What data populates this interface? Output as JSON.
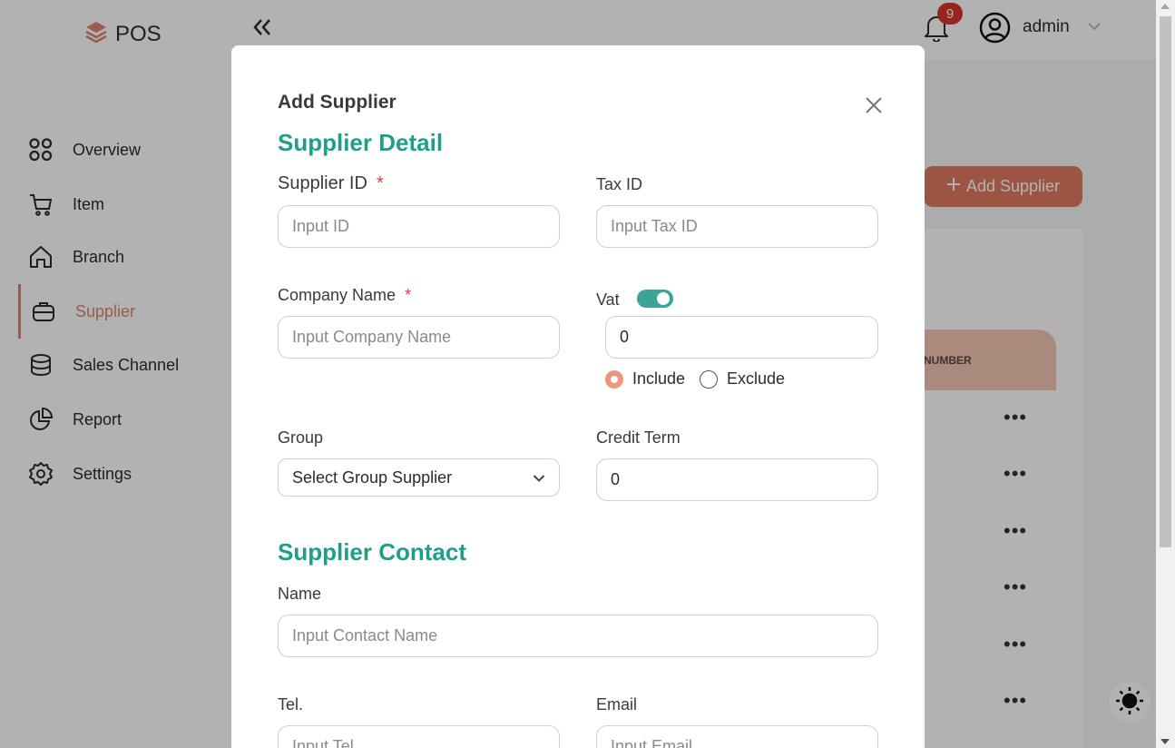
{
  "app": {
    "logo_text": "POS"
  },
  "sidebar": {
    "items": [
      {
        "label": "Overview",
        "icon": "grid-icon"
      },
      {
        "label": "Item",
        "icon": "cart-icon"
      },
      {
        "label": "Branch",
        "icon": "home-icon"
      },
      {
        "label": "Supplier",
        "icon": "briefcase-icon",
        "active": true
      },
      {
        "label": "Sales Channel",
        "icon": "database-icon"
      },
      {
        "label": "Report",
        "icon": "pie-chart-icon"
      },
      {
        "label": "Settings",
        "icon": "gear-icon"
      }
    ]
  },
  "header": {
    "notification_count": "9",
    "user_name": "admin"
  },
  "page": {
    "add_button_label": "Add Supplier",
    "table_header_partial": "NUMBER"
  },
  "modal": {
    "title": "Add Supplier",
    "detail_section": "Supplier Detail",
    "supplier_id": {
      "label": "Supplier ID",
      "required": "*",
      "placeholder": "Input ID"
    },
    "tax_id": {
      "label": "Tax ID",
      "placeholder": "Input Tax ID"
    },
    "company_name": {
      "label": "Company Name",
      "required": "*",
      "placeholder": "Input Company Name"
    },
    "vat": {
      "label": "Vat",
      "value": "0",
      "enabled": true,
      "include_label": "Include",
      "exclude_label": "Exclude",
      "selected": "Include"
    },
    "group": {
      "label": "Group",
      "selected": "Select Group Supplier"
    },
    "credit_term": {
      "label": "Credit Term",
      "value": "0"
    },
    "contact_section": "Supplier Contact",
    "contact_name": {
      "label": "Name",
      "placeholder": "Input Contact Name"
    },
    "tel": {
      "label": "Tel.",
      "placeholder": "Input Tel."
    },
    "email": {
      "label": "Email",
      "placeholder": "Input Email"
    }
  },
  "colors": {
    "accent": "#e07a5f",
    "teal": "#1f9e8a",
    "badge": "#d9342b"
  }
}
